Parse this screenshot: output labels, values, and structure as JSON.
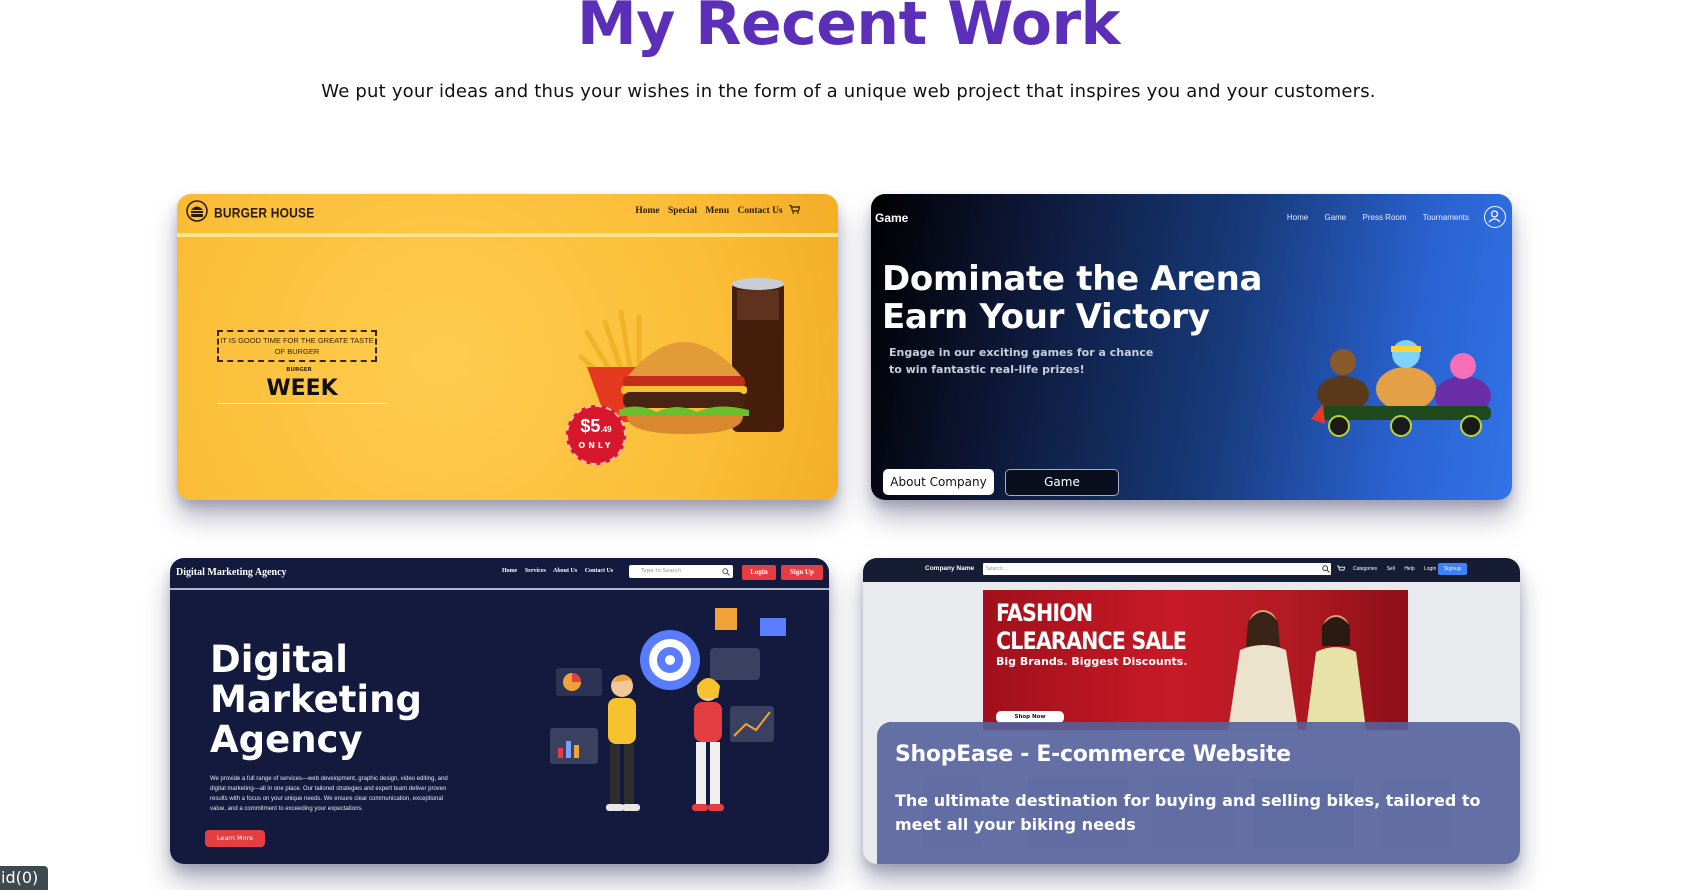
{
  "section": {
    "title": "My Recent Work",
    "subtitle": "We put your ideas and thus your wishes in the form of a unique web project that inspires you and your customers."
  },
  "projects": [
    {
      "name": "burger-house",
      "brand": "BURGER HOUSE",
      "nav": [
        "Home",
        "Special",
        "Menu",
        "Contact Us"
      ],
      "promo_text": "IT IS GOOD TIME FOR THE GREATE TASTE OF BURGER",
      "promo_small": "BURGER",
      "promo_big": "WEEK",
      "price_main": "$5",
      "price_cents": ".49",
      "price_note": "ONLY",
      "colors": {
        "background": "#fbbd37",
        "badge": "#d7172c"
      }
    },
    {
      "name": "game",
      "brand": "Game",
      "nav": [
        "Home",
        "Game",
        "Press Room",
        "Tournaments"
      ],
      "headline_line1": "Dominate the Arena",
      "headline_line2": "Earn Your Victory",
      "subtext": "Engage in our exciting games for a chance to win fantastic real-life prizes!",
      "button_primary": "About Company",
      "button_secondary": "Game",
      "icons": [
        "user-icon"
      ],
      "colors": {
        "gradient_start": "#000000",
        "gradient_end": "#3174e8"
      }
    },
    {
      "name": "digital-marketing",
      "brand": "Digital Marketing Agency",
      "nav": [
        "Home",
        "Services",
        "About Us",
        "Contact Us"
      ],
      "search_placeholder": "Type to Search",
      "login": "Login",
      "signup": "Sign Up",
      "headline_line1": "Digital",
      "headline_line2": "Marketing",
      "headline_line3": "Agency",
      "paragraph": "We provide a full range of services—web development, graphic design, video editing, and digital marketing—all in one place. Our tailored strategies and expert team deliver proven results with a focus on your unique needs. We ensure clear communication, exceptional value, and a commitment to exceeding your expectations.",
      "cta": "Learn More",
      "colors": {
        "background": "#131a3d",
        "accent": "#e43e43"
      }
    },
    {
      "name": "shopease",
      "brand": "Company Name",
      "search_placeholder": "Search...",
      "nav": [
        "Categories",
        "Sell",
        "Help",
        "Login"
      ],
      "signup": "Signup",
      "banner_line1": "FASHION",
      "banner_line2": "CLEARANCE SALE",
      "banner_sub": "Big Brands. Biggest Discounts.",
      "banner_button": "Shop Now",
      "overlay_title": "ShopEase - E-commerce Website",
      "overlay_desc": "The ultimate destination for buying and selling bikes, tailored to meet all your biking needs",
      "colors": {
        "overlay": "#54629c",
        "banner": "#c71a26"
      }
    }
  ],
  "debug_badge": "id(0)"
}
